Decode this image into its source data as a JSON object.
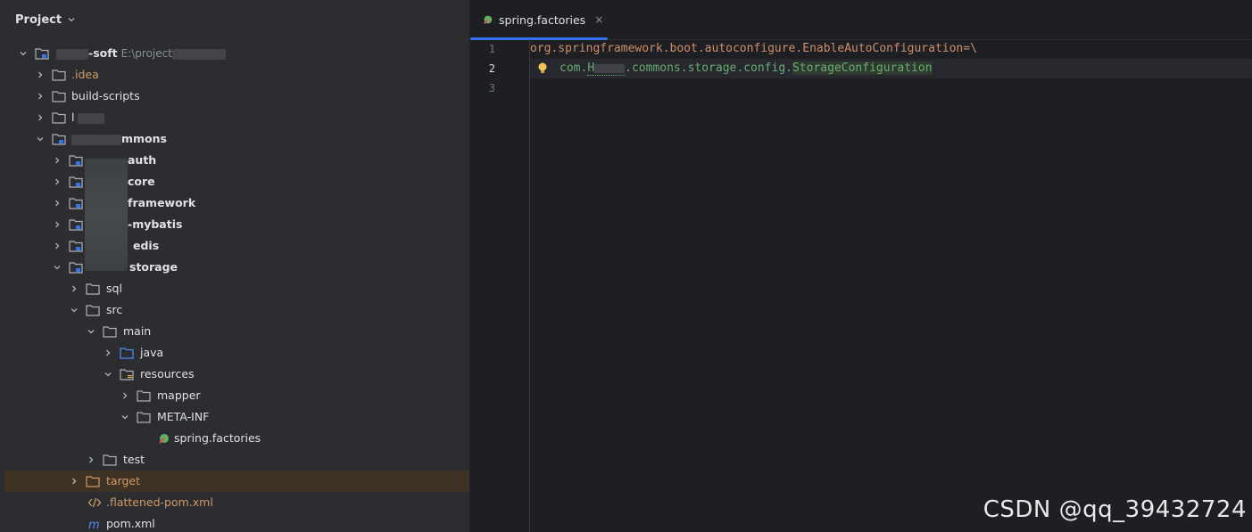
{
  "panel": {
    "title": "Project"
  },
  "tree": [
    {
      "label": "-soft",
      "path": "E:\\project",
      "kind": "module",
      "bold": true
    },
    {
      "label": ".idea",
      "kind": "folder",
      "orange": true
    },
    {
      "label": "build-scripts",
      "kind": "folder"
    },
    {
      "label": "l",
      "kind": "folder"
    },
    {
      "label": "mmons",
      "kind": "module",
      "bold": true
    },
    {
      "label": "auth",
      "kind": "module",
      "bold": true
    },
    {
      "label": "core",
      "kind": "module",
      "bold": true
    },
    {
      "label": "framework",
      "kind": "module",
      "bold": true
    },
    {
      "label": "-mybatis",
      "kind": "module",
      "bold": true
    },
    {
      "label": "edis",
      "kind": "module",
      "bold": true
    },
    {
      "label": "storage",
      "kind": "module",
      "bold": true
    },
    {
      "label": "sql",
      "kind": "folder"
    },
    {
      "label": "src",
      "kind": "folder"
    },
    {
      "label": "main",
      "kind": "folder"
    },
    {
      "label": "java",
      "kind": "source-folder"
    },
    {
      "label": "resources",
      "kind": "resources-folder"
    },
    {
      "label": "mapper",
      "kind": "folder"
    },
    {
      "label": "META-INF",
      "kind": "folder"
    },
    {
      "label": "spring.factories",
      "kind": "spring-file"
    },
    {
      "label": "test",
      "kind": "folder"
    },
    {
      "label": "target",
      "kind": "excluded-folder",
      "orange": true
    },
    {
      "label": ".flattened-pom.xml",
      "kind": "xml-file",
      "orange": true
    },
    {
      "label": "pom.xml",
      "kind": "maven-file"
    }
  ],
  "editor": {
    "tab_label": "spring.factories",
    "tab_close": "×",
    "line_numbers": [
      "1",
      "2",
      "3"
    ],
    "line1": "org.springframework.boot.autoconfigure.EnableAutoConfiguration=\\",
    "line2_prefix": "com.",
    "line2_obscured": "H",
    "line2_mid": "commons.storage.config.",
    "line2_class": "StorageConfiguration"
  },
  "watermark": "CSDN @qq_39432724",
  "colors": {
    "accent": "#3574f0",
    "highlight_row": "#3d3223",
    "excluded": "#d19a66"
  }
}
